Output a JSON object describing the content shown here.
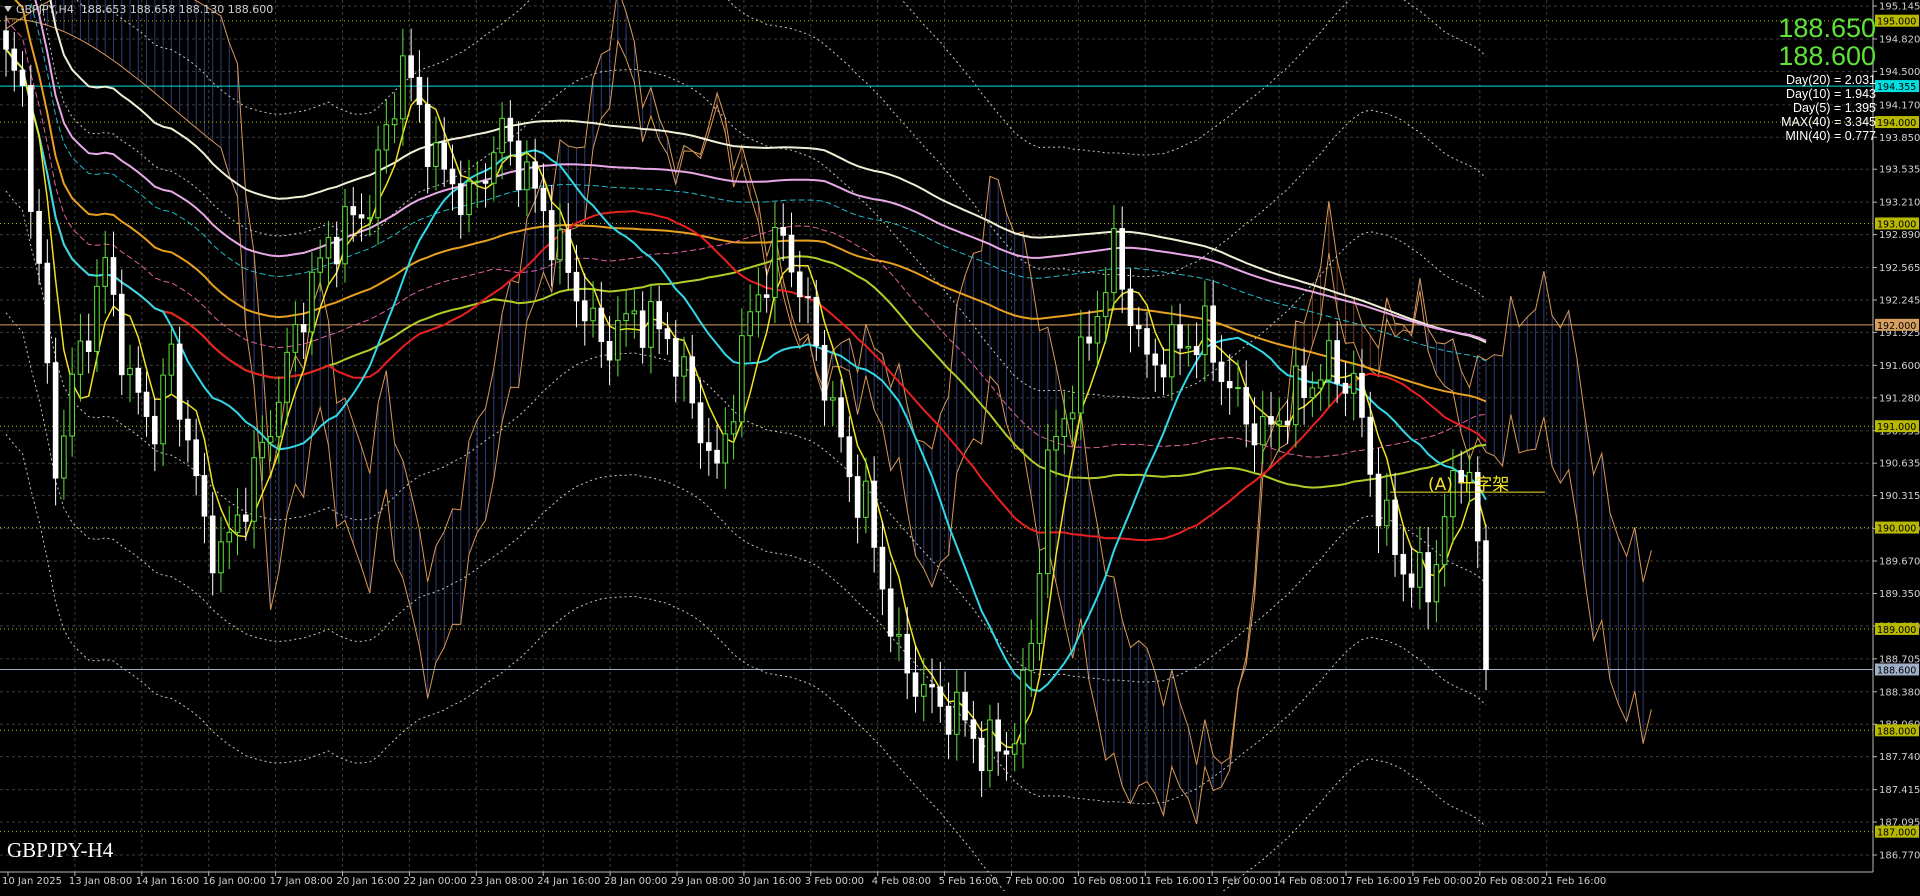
{
  "header": {
    "symbol_tf": "GBPJPY,H4",
    "ohlc": "188.653 188.658 188.130 188.600"
  },
  "quote": {
    "bid": "188.650",
    "ask": "188.600"
  },
  "stats": [
    "Day(20) = 2.031",
    "Day(10) = 1.943",
    "Day(5) = 1.395",
    "MAX(40) = 3.345",
    "MIN(40) = 0.777"
  ],
  "symbol_label": "GBPJPY-H4",
  "annotation": "(A) 十字架",
  "price_axis": {
    "min": 186.77,
    "max": 195.145,
    "labels": [
      "195.145",
      "194.820",
      "194.500",
      "194.170",
      "193.850",
      "193.535",
      "193.210",
      "192.890",
      "192.565",
      "192.245",
      "191.925",
      "191.600",
      "191.280",
      "190.955",
      "190.635",
      "190.315",
      "189.990",
      "189.670",
      "189.350",
      "189.030",
      "188.705",
      "188.380",
      "188.060",
      "187.740",
      "187.415",
      "187.095",
      "186.770"
    ]
  },
  "level_lines": [
    {
      "price": "195.000",
      "color": "#b8b800",
      "style": "dotted"
    },
    {
      "price": "194.355",
      "color": "#00e0e0",
      "style": "solid"
    },
    {
      "price": "194.000",
      "color": "#b8b800",
      "style": "dotted"
    },
    {
      "price": "193.000",
      "color": "#b8b800",
      "style": "dotted"
    },
    {
      "price": "192.000",
      "color": "#d8a060",
      "style": "solid"
    },
    {
      "price": "191.000",
      "color": "#b8b800",
      "style": "dotted"
    },
    {
      "price": "190.000",
      "color": "#b8b800",
      "style": "dotted"
    },
    {
      "price": "189.000",
      "color": "#b8b800",
      "style": "dotted"
    },
    {
      "price": "188.600",
      "color": "#9fb0c8",
      "style": "solid"
    },
    {
      "price": "188.000",
      "color": "#b8b800",
      "style": "dotted"
    },
    {
      "price": "187.000",
      "color": "#b8b800",
      "style": "dotted"
    }
  ],
  "time_axis": [
    "10 Jan 2025",
    "13 Jan 08:00",
    "14 Jan 16:00",
    "16 Jan 00:00",
    "17 Jan 08:00",
    "20 Jan 16:00",
    "22 Jan 00:00",
    "23 Jan 08:00",
    "24 Jan 16:00",
    "28 Jan 00:00",
    "29 Jan 08:00",
    "30 Jan 16:00",
    "3 Feb 00:00",
    "4 Feb 08:00",
    "5 Feb 16:00",
    "7 Feb 00:00",
    "10 Feb 08:00",
    "11 Feb 16:00",
    "13 Feb 00:00",
    "14 Feb 08:00",
    "17 Feb 16:00",
    "19 Feb 00:00",
    "20 Feb 08:00",
    "21 Feb 16:00"
  ],
  "colors": {
    "bull_candle": "#5fe23a",
    "bear_candle": "#ffffff",
    "grid": "#3c3c3c",
    "ma_cyan": "#32d8e8",
    "ma_red": "#e82020",
    "ma_yellow": "#f2e321",
    "ma_olive": "#b4cc28",
    "ma_orange": "#e8a020",
    "ma_pink": "#e8a8e8",
    "ma_white": "#f0f0d8",
    "cloud_bear": "#a05038",
    "cloud_bull": "#4050a0"
  }
}
